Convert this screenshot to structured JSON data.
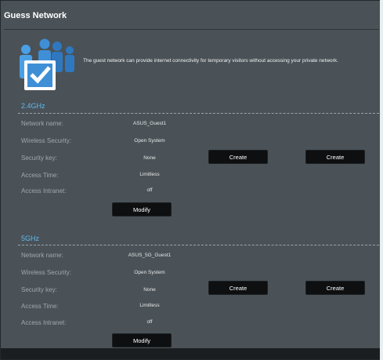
{
  "page": {
    "title": "Guess Network"
  },
  "intro": {
    "icon": "guest-network-icon",
    "text": "The guest network can provide internet connectivity for temporary visitors without accessing your private network."
  },
  "bands": [
    {
      "label": "2.4GHz",
      "rows": [
        {
          "label": "Network name:",
          "value": "ASUS_Guest1"
        },
        {
          "label": "Wireless Security:",
          "value": "Open System"
        },
        {
          "label": "Security key:",
          "value": "None"
        },
        {
          "label": "Access Time:",
          "value": "Limitless"
        },
        {
          "label": "Access Intranet:",
          "value": "off"
        }
      ],
      "create_label_1": "Create",
      "create_label_2": "Create",
      "modify_label": "Modify"
    },
    {
      "label": "5GHz",
      "rows": [
        {
          "label": "Network name:",
          "value": "ASUS_5G_Guest1"
        },
        {
          "label": "Wireless Security:",
          "value": "Open System"
        },
        {
          "label": "Security key:",
          "value": "None"
        },
        {
          "label": "Access Time:",
          "value": "Limitless"
        },
        {
          "label": "Access Intranet:",
          "value": "off"
        }
      ],
      "create_label_1": "Create",
      "create_label_2": "Create",
      "modify_label": "Modify"
    }
  ],
  "colors": {
    "background": "#4a5257",
    "band_label": "#5fb8ee",
    "button": "#0d0f10",
    "icon_blue": "#3f8fd6"
  }
}
